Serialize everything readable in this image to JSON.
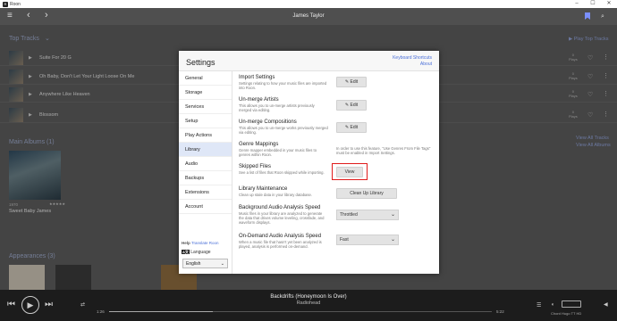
{
  "titlebar": {
    "app": "Roon"
  },
  "header": {
    "title": "James Taylor"
  },
  "top_tracks": {
    "title": "Top Tracks",
    "play_link": "Play Top Tracks",
    "tracks": [
      {
        "name": "Suite For 20 G",
        "plays": "0",
        "plays_label": "Plays"
      },
      {
        "name": "Oh Baby, Don't Let Your Light Loose On Me",
        "plays": "0",
        "plays_label": "Plays"
      },
      {
        "name": "Anywhere Like Heaven",
        "plays": "0",
        "plays_label": "Plays"
      },
      {
        "name": "Blossom",
        "plays": "0",
        "plays_label": "Plays"
      }
    ],
    "view_all": "View All Tracks"
  },
  "main_albums": {
    "title": "Main Albums (1)",
    "view_all": "View All Albums",
    "album": {
      "year": "1970",
      "name": "Sweet Baby James",
      "stars": "★★★★★"
    }
  },
  "appearances": {
    "title": "Appearances (3)"
  },
  "player": {
    "track": "Backdrifts (Honeymoon Is Over)",
    "artist": "Radiohead",
    "elapsed": "1:26",
    "duration": "5:22",
    "progress": 0.27,
    "zone": "Chord Hugo TT HD"
  },
  "settings": {
    "title": "Settings",
    "link_shortcuts": "Keyboard Shortcuts",
    "link_about": "About",
    "nav": [
      "General",
      "Storage",
      "Services",
      "Setup",
      "Play Actions",
      "Library",
      "Audio",
      "Backups",
      "Extensions",
      "Account"
    ],
    "active_nav": "Library",
    "help": "Help",
    "help_link": "Translate Roon",
    "language_label": "Language",
    "language_value": "English",
    "rows": [
      {
        "title": "Import Settings",
        "desc": "Settings relating to how your music files are imported into Roon.",
        "button": "Edit"
      },
      {
        "title": "Un-merge Artists",
        "desc": "This allows you to un-merge artists previously merged via editing.",
        "button": "Edit"
      },
      {
        "title": "Un-merge Compositions",
        "desc": "This allows you to un-merge works previously merged via editing.",
        "button": "Edit"
      },
      {
        "title": "Genre Mappings",
        "desc": "Genre mapper embedded in your music files to genres within Roon.",
        "note": "In order to use this feature, \"Use Genres From File Tags\" must be enabled in Import Settings."
      },
      {
        "title": "Skipped Files",
        "desc": "See a list of files that Roon skipped while importing.",
        "button": "View"
      },
      {
        "title": "Library Maintenance",
        "desc": "Clean up stale data in your library database.",
        "button": "Clean Up Library"
      },
      {
        "title": "Background Audio Analysis Speed",
        "desc": "Music files in your library are analyzed to generate the data that drives volume leveling, crossfade, and waveform displays.",
        "select": "Throttled"
      },
      {
        "title": "On-Demand Audio Analysis Speed",
        "desc": "When a music file that hasn't yet been analyzed is played, analysis is performed on-demand.",
        "select": "Fast"
      }
    ]
  }
}
